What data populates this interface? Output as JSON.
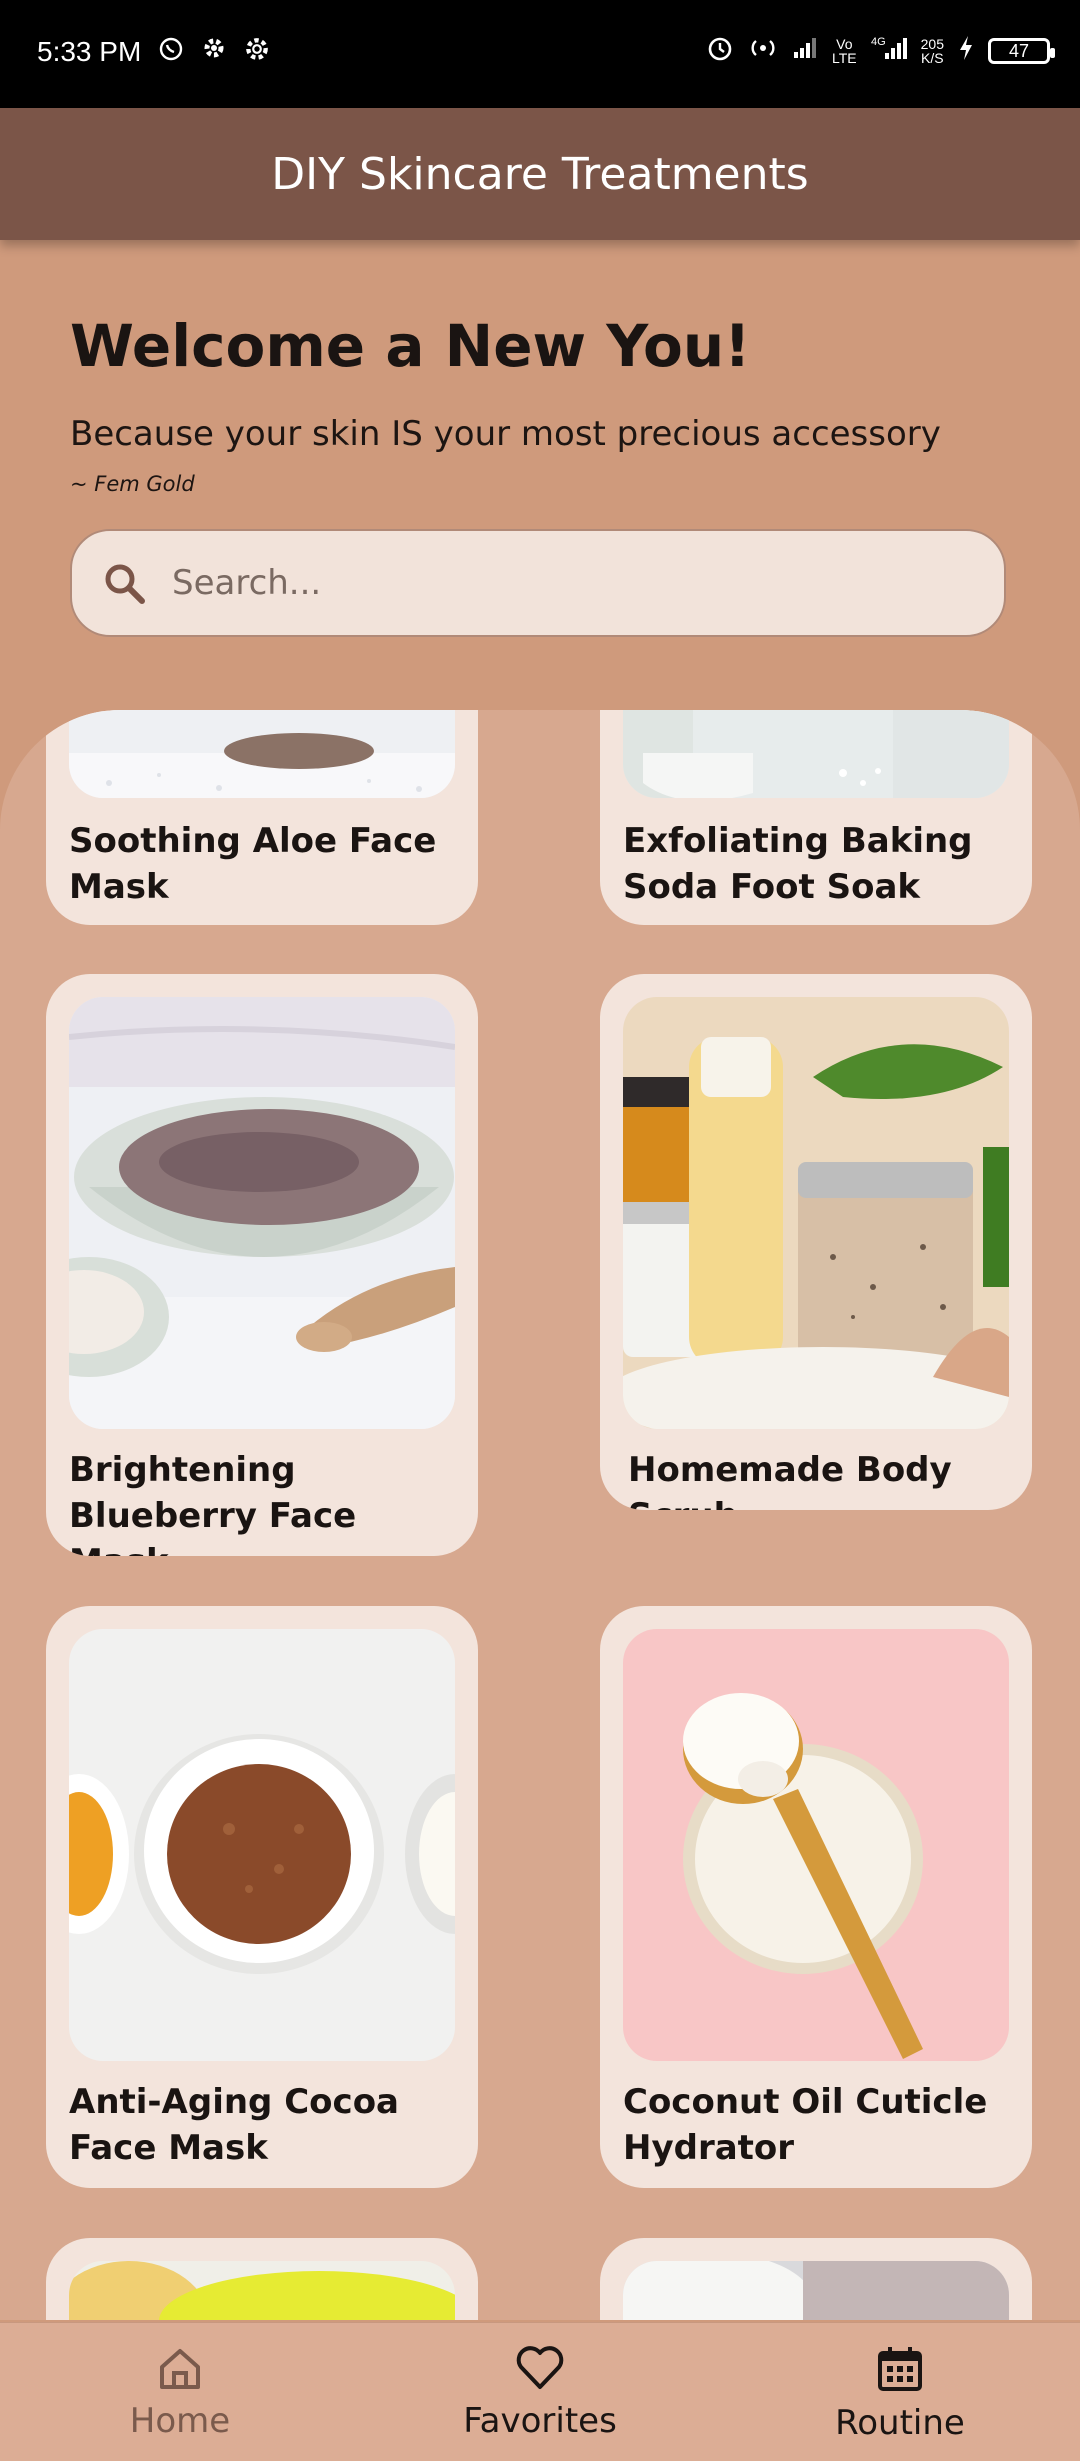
{
  "status_bar": {
    "time": "5:33 PM",
    "network_speed_top": "205",
    "network_speed_bottom": "K/S",
    "battery": "47"
  },
  "app_bar": {
    "title": "DIY Skincare Treatments"
  },
  "header": {
    "welcome": "Welcome a New You!",
    "subtitle": "Because your skin IS your most precious accessory",
    "author": "~ Fem Gold"
  },
  "search": {
    "placeholder": "Search..."
  },
  "cards": [
    {
      "title": "Soothing Aloe Face Mask"
    },
    {
      "title": "Exfoliating Baking Soda Foot Soak"
    },
    {
      "title": "Brightening Blueberry Face Mask"
    },
    {
      "title": "Homemade Body Scrub"
    },
    {
      "title": " Anti-Aging Cocoa Face Mask"
    },
    {
      "title": "Coconut Oil Cuticle Hydrator"
    }
  ],
  "nav": [
    {
      "label": "Home",
      "icon": "home-icon"
    },
    {
      "label": "Favorites",
      "icon": "heart-icon"
    },
    {
      "label": "Routine",
      "icon": "calendar-icon"
    }
  ],
  "colors": {
    "app_bar": "#7b5548",
    "background": "#cf9a7c",
    "panel": "#d7a88f",
    "card": "#f3e4dc",
    "nav_inactive": "#7a5a4c"
  }
}
